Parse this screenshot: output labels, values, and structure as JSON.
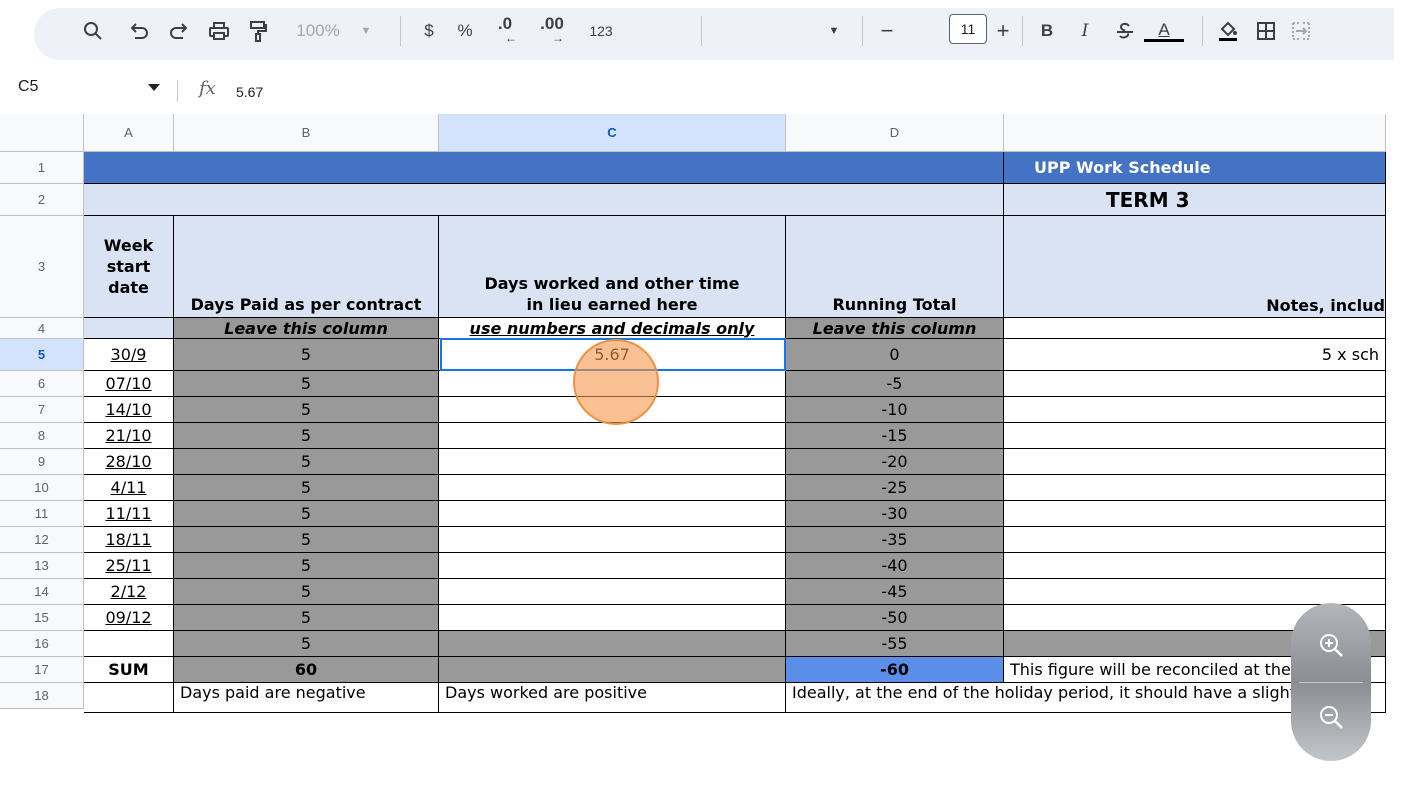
{
  "toolbar": {
    "zoom": "100%",
    "currency": "$",
    "percent": "%",
    "decrease_decimals": ".0",
    "increase_decimals": ".00",
    "number_format": "123",
    "font_size": "11",
    "font_size_minus": "−",
    "font_size_plus": "+",
    "bold": "B",
    "italic": "I",
    "text_color_letter": "A"
  },
  "formula_bar": {
    "name_box": "C5",
    "fx_label": "fx",
    "value": "5.67"
  },
  "columns": [
    "A",
    "B",
    "C",
    "D"
  ],
  "rows": [
    "1",
    "2",
    "3",
    "4",
    "5",
    "6",
    "7",
    "8",
    "9",
    "10",
    "11",
    "12",
    "13",
    "14",
    "15",
    "16",
    "17",
    "18"
  ],
  "sheet": {
    "title": "UPP Work Schedule",
    "term": "TERM 3",
    "headers": {
      "week_start": "Week start date",
      "days_paid": "Days Paid as per contract",
      "days_worked": "Days worked and other time in lieu earned here",
      "running_total": "Running Total",
      "notes": "Notes, includ"
    },
    "instructions": {
      "days_paid": "Leave this column",
      "days_worked": "use numbers and decimals only",
      "running_total": "Leave this column"
    },
    "data_rows": [
      {
        "date": "30/9",
        "paid": "5",
        "worked": "5.67",
        "total": "0",
        "note": "5 x sch"
      },
      {
        "date": "07/10",
        "paid": "5",
        "worked": "",
        "total": "-5",
        "note": ""
      },
      {
        "date": "14/10",
        "paid": "5",
        "worked": "",
        "total": "-10",
        "note": ""
      },
      {
        "date": "21/10",
        "paid": "5",
        "worked": "",
        "total": "-15",
        "note": ""
      },
      {
        "date": "28/10",
        "paid": "5",
        "worked": "",
        "total": "-20",
        "note": ""
      },
      {
        "date": "4/11",
        "paid": "5",
        "worked": "",
        "total": "-25",
        "note": ""
      },
      {
        "date": "11/11",
        "paid": "5",
        "worked": "",
        "total": "-30",
        "note": ""
      },
      {
        "date": "18/11",
        "paid": "5",
        "worked": "",
        "total": "-35",
        "note": ""
      },
      {
        "date": "25/11",
        "paid": "5",
        "worked": "",
        "total": "-40",
        "note": ""
      },
      {
        "date": "2/12",
        "paid": "5",
        "worked": "",
        "total": "-45",
        "note": ""
      },
      {
        "date": "09/12",
        "paid": "5",
        "worked": "",
        "total": "-50",
        "note": ""
      },
      {
        "date": "",
        "paid": "5",
        "worked": "",
        "total": "-55",
        "note": ""
      }
    ],
    "sum_row": {
      "label": "SUM",
      "paid": "60",
      "worked": "",
      "total": "-60",
      "note": "This figure will be reconciled at the end"
    },
    "row18": {
      "paid": "Days paid are negative",
      "worked": "Days worked are positive",
      "total": "Ideally, at the end of the holiday period, it should have a slight"
    }
  },
  "colors": {
    "title_band": "#4472c4",
    "light_band": "#dae3f3",
    "gray_column": "#999999",
    "total_highlight": "#5a8ee8",
    "selection": "#1a73e8"
  },
  "icons": [
    "search-icon",
    "undo-icon",
    "redo-icon",
    "print-icon",
    "paint-format-icon",
    "zoom-dropdown-icon",
    "decrease-decimal-arrow-icon",
    "increase-decimal-arrow-icon",
    "font-dropdown-icon",
    "strikethrough-icon",
    "fill-color-icon",
    "borders-icon",
    "merge-icon",
    "zoom-in-icon",
    "zoom-out-icon"
  ]
}
